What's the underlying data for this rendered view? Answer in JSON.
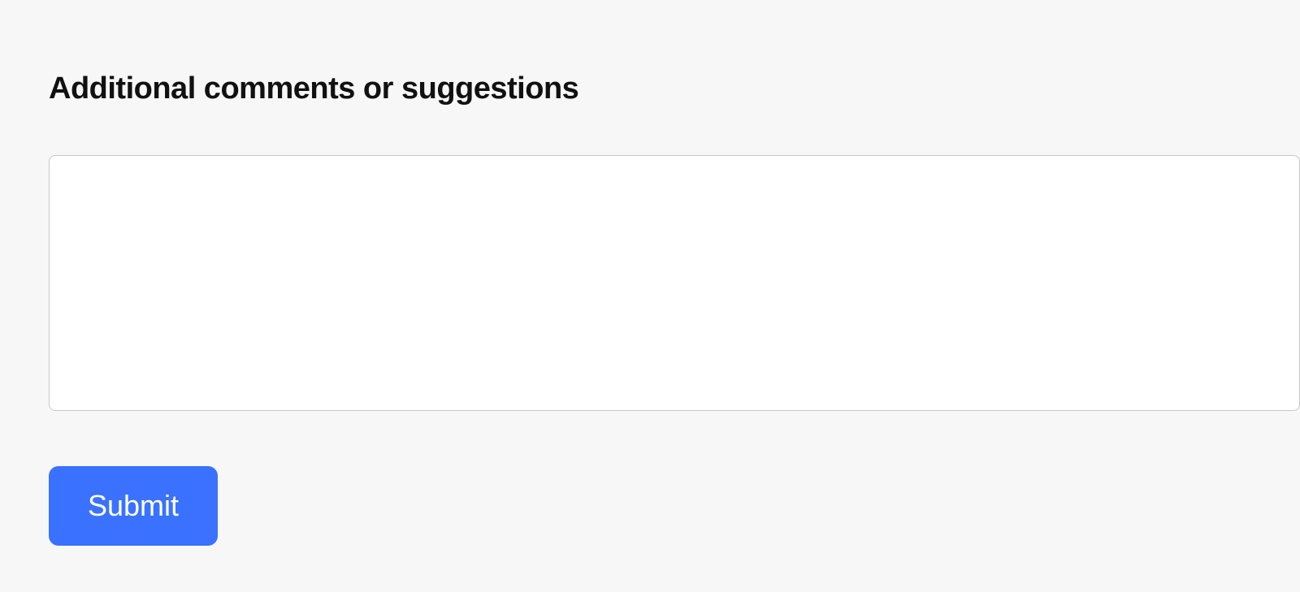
{
  "form": {
    "comments_label": "Additional comments or suggestions",
    "comments_value": "",
    "submit_label": "Submit"
  }
}
